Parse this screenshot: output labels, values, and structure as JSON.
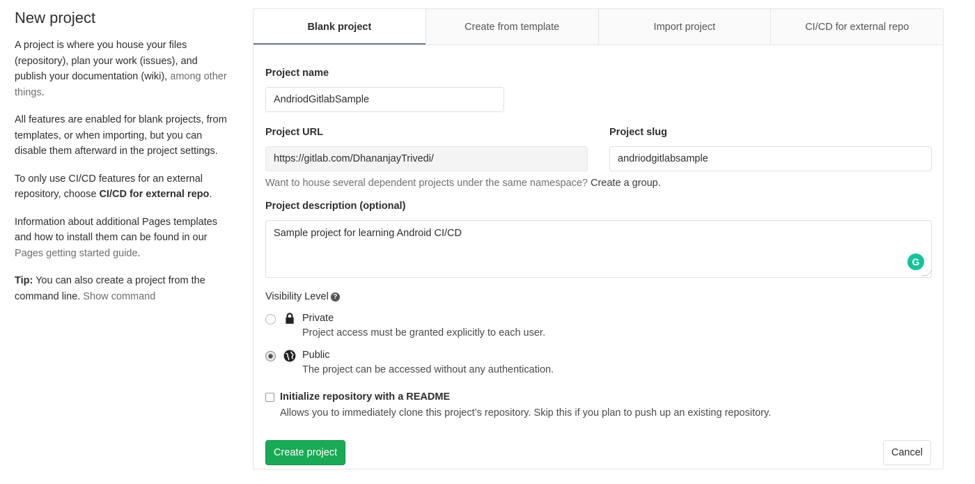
{
  "sidebar": {
    "title": "New project",
    "p1_text": "A project is where you house your files (repository), plan your work (issues), and publish your documentation (wiki), ",
    "p1_link": "among other things",
    "p1_end": ".",
    "p2": "All features are enabled for blank projects, from templates, or when importing, but you can disable them afterward in the project settings.",
    "p3_text": "To only use CI/CD features for an external repository, choose ",
    "p3_bold": "CI/CD for external repo",
    "p3_end": ".",
    "p4_text": "Information about additional Pages templates and how to install them can be found in our ",
    "p4_link": "Pages getting started guide",
    "p4_end": ".",
    "tip_label": "Tip:",
    "tip_text": " You can also create a project from the command line. ",
    "tip_link": "Show command"
  },
  "tabs": [
    {
      "label": "Blank project",
      "active": true
    },
    {
      "label": "Create from template"
    },
    {
      "label": "Import project"
    },
    {
      "label": "CI/CD for external repo"
    }
  ],
  "form": {
    "project_name_label": "Project name",
    "project_name_value": "AndriodGitlabSample",
    "project_url_label": "Project URL",
    "project_url_value": "https://gitlab.com/DhananjayTrivedi/",
    "project_slug_label": "Project slug",
    "project_slug_value": "andriodgitlabsample",
    "group_hint": "Want to house several dependent projects under the same namespace? ",
    "group_link": "Create a group.",
    "description_label": "Project description (optional)",
    "description_value": "Sample project for learning Android CI/CD",
    "grammarly_icon": "G",
    "visibility_label": "Visibility Level",
    "help_icon": "?",
    "visibility_options": [
      {
        "title": "Private",
        "desc": "Project access must be granted explicitly to each user.",
        "icon": "lock-icon",
        "checked": false
      },
      {
        "title": "Public",
        "desc": "The project can be accessed without any authentication.",
        "icon": "globe-icon",
        "checked": true
      }
    ],
    "readme_label": "Initialize repository with a README",
    "readme_desc": "Allows you to immediately clone this project’s repository. Skip this if you plan to push up an existing repository.",
    "create_button": "Create project",
    "cancel_button": "Cancel"
  },
  "colors": {
    "primary_button": "#1aaa55",
    "grammarly": "#15c39a"
  }
}
